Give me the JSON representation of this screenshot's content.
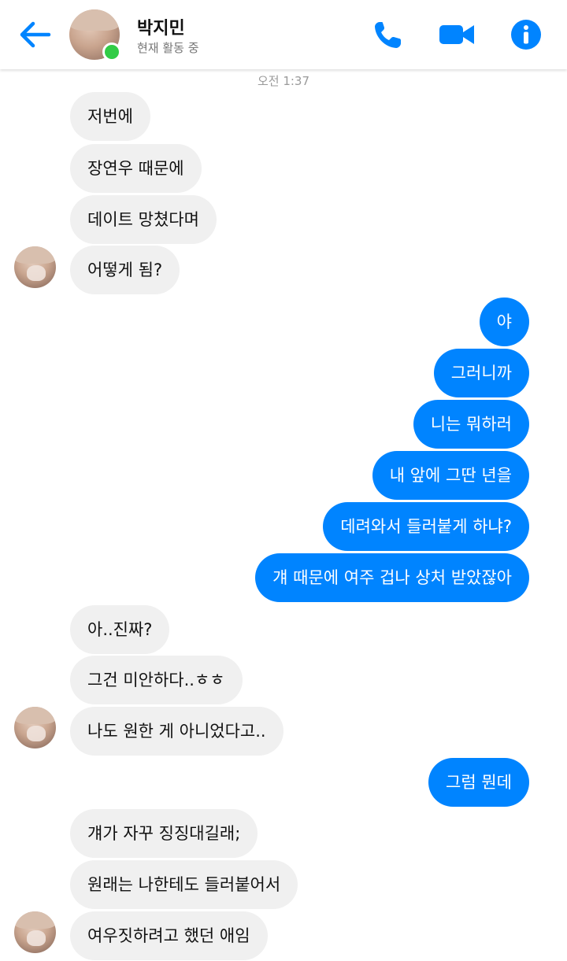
{
  "header": {
    "contact_name": "박지민",
    "status": "현재 활동 중",
    "accent_color": "#0084ff",
    "online_color": "#31cc46",
    "icons": [
      "back-arrow-icon",
      "phone-icon",
      "video-camera-icon",
      "info-icon"
    ]
  },
  "timestamp": "오전 1:37",
  "messages": [
    {
      "from": "them",
      "text": "저번에"
    },
    {
      "from": "them",
      "text": "장연우 때문에"
    },
    {
      "from": "them",
      "text": "데이트 망쳤다며"
    },
    {
      "from": "them",
      "text": "어떻게 됨?"
    },
    {
      "from": "me",
      "text": "야"
    },
    {
      "from": "me",
      "text": "그러니까"
    },
    {
      "from": "me",
      "text": "니는 뭐하러"
    },
    {
      "from": "me",
      "text": "내 앞에 그딴 년을"
    },
    {
      "from": "me",
      "text": "데려와서 들러붙게 하냐?"
    },
    {
      "from": "me",
      "text": "걔 때문에 여주 겁나 상처 받았잖아"
    },
    {
      "from": "them",
      "text": "아..진짜?"
    },
    {
      "from": "them",
      "text": "그건 미안하다..ㅎㅎ"
    },
    {
      "from": "them",
      "text": "나도 원한 게 아니었다고.."
    },
    {
      "from": "me",
      "text": "그럼 뭔데"
    },
    {
      "from": "them",
      "text": "걔가 자꾸 징징대길래;"
    },
    {
      "from": "them",
      "text": "원래는 나한테도 들러붙어서"
    },
    {
      "from": "them",
      "text": "여우짓하려고 했던 애임"
    }
  ]
}
